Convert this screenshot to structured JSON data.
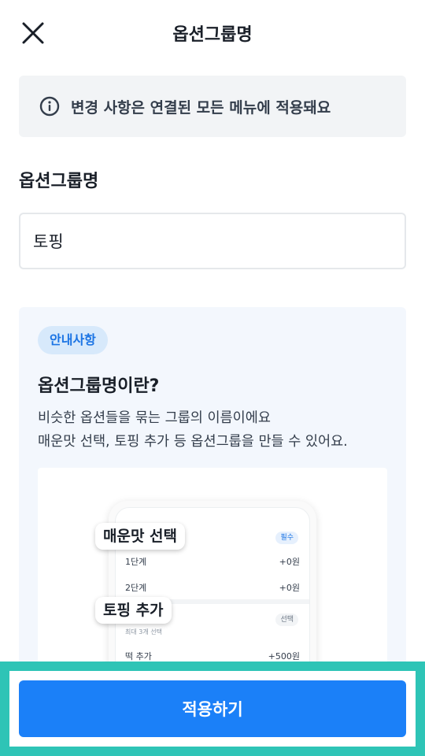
{
  "header": {
    "title": "옵션그룹명",
    "close_icon": "close-icon"
  },
  "notice": {
    "icon": "info-icon",
    "text": "변경 사항은 연결된 모든 메뉴에 적용돼요"
  },
  "form": {
    "label": "옵션그룹명",
    "value": "토핑"
  },
  "guide": {
    "badge": "안내사항",
    "title": "옵션그룹명이란?",
    "desc_lines": [
      "비슷한 옵션들을 묶는 그룹의 이름이에요",
      "매운맛 선택, 토핑 추가 등 옵션그룹을 만들 수 있어요."
    ],
    "illustration": {
      "callouts": [
        "매운맛 선택",
        "토핑 추가"
      ],
      "group1": {
        "badge": "필수",
        "rows": [
          {
            "name": "1단계",
            "price": "+0원"
          },
          {
            "name": "2단계",
            "price": "+0원"
          }
        ]
      },
      "group2": {
        "badge": "선택",
        "note": "최대 3개 선택",
        "rows": [
          {
            "name": "떡 추가",
            "price": "+500원"
          }
        ]
      }
    }
  },
  "cta": {
    "label": "적용하기"
  },
  "colors": {
    "accent": "#1b80f8",
    "highlight_border": "#2ec4b6",
    "badge_bg": "#d7e9fb"
  }
}
